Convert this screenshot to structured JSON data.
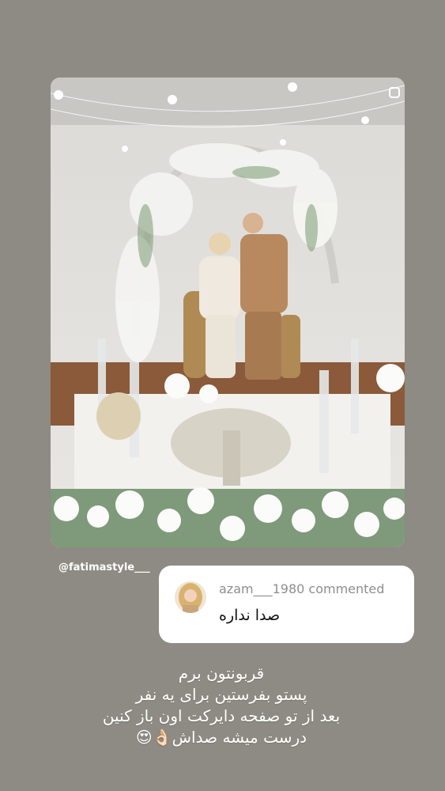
{
  "story": {
    "mention": "@fatimastyle___",
    "comment": {
      "username": "azam___1980 commented",
      "text": "صدا نداره"
    },
    "caption_lines": [
      "قربونتون برم",
      "پستو بفرستین برای یه نفر",
      "بعد از تو صفحه دایرکت اون باز کنین",
      "درست میشه صداش👌🏻😍"
    ]
  },
  "icons": {
    "photo_corner": "square-outline-icon"
  }
}
